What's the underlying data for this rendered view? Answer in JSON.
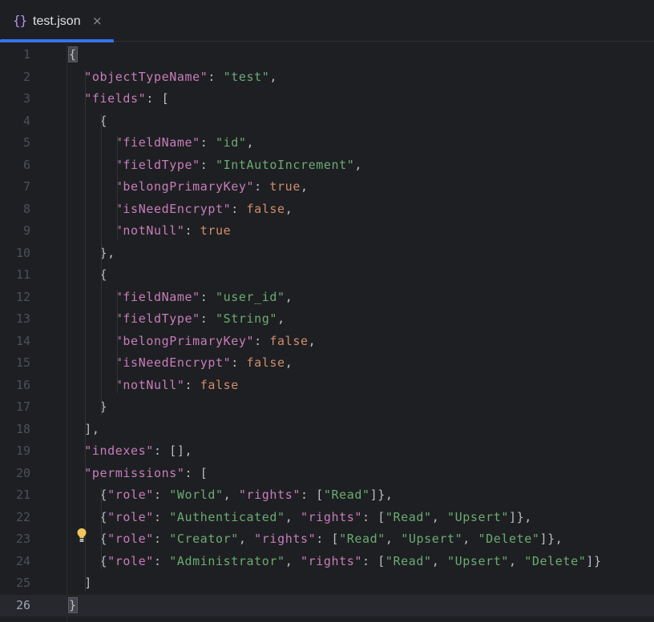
{
  "tab": {
    "icon": "{}",
    "label": "test.json",
    "close": "×"
  },
  "editor": {
    "current_line": 26,
    "lines": [
      {
        "n": "1",
        "tokens": [
          [
            "p",
            "{"
          ]
        ]
      },
      {
        "n": "2",
        "tokens": [
          [
            "p",
            "  "
          ],
          [
            "k",
            "\"objectTypeName\""
          ],
          [
            "p",
            ": "
          ],
          [
            "s",
            "\"test\""
          ],
          [
            "p",
            ","
          ]
        ]
      },
      {
        "n": "3",
        "tokens": [
          [
            "p",
            "  "
          ],
          [
            "k",
            "\"fields\""
          ],
          [
            "p",
            ": ["
          ]
        ]
      },
      {
        "n": "4",
        "tokens": [
          [
            "p",
            "    {"
          ]
        ]
      },
      {
        "n": "5",
        "tokens": [
          [
            "p",
            "      "
          ],
          [
            "k",
            "\"fieldName\""
          ],
          [
            "p",
            ": "
          ],
          [
            "s",
            "\"id\""
          ],
          [
            "p",
            ","
          ]
        ]
      },
      {
        "n": "6",
        "tokens": [
          [
            "p",
            "      "
          ],
          [
            "k",
            "\"fieldType\""
          ],
          [
            "p",
            ": "
          ],
          [
            "s",
            "\"IntAutoIncrement\""
          ],
          [
            "p",
            ","
          ]
        ]
      },
      {
        "n": "7",
        "tokens": [
          [
            "p",
            "      "
          ],
          [
            "k",
            "\"belongPrimaryKey\""
          ],
          [
            "p",
            ": "
          ],
          [
            "b",
            "true"
          ],
          [
            "p",
            ","
          ]
        ]
      },
      {
        "n": "8",
        "tokens": [
          [
            "p",
            "      "
          ],
          [
            "k",
            "\"isNeedEncrypt\""
          ],
          [
            "p",
            ": "
          ],
          [
            "b",
            "false"
          ],
          [
            "p",
            ","
          ]
        ]
      },
      {
        "n": "9",
        "tokens": [
          [
            "p",
            "      "
          ],
          [
            "k",
            "\"notNull\""
          ],
          [
            "p",
            ": "
          ],
          [
            "b",
            "true"
          ]
        ]
      },
      {
        "n": "10",
        "tokens": [
          [
            "p",
            "    },"
          ]
        ]
      },
      {
        "n": "11",
        "tokens": [
          [
            "p",
            "    {"
          ]
        ]
      },
      {
        "n": "12",
        "tokens": [
          [
            "p",
            "      "
          ],
          [
            "k",
            "\"fieldName\""
          ],
          [
            "p",
            ": "
          ],
          [
            "s",
            "\"user_id\""
          ],
          [
            "p",
            ","
          ]
        ]
      },
      {
        "n": "13",
        "tokens": [
          [
            "p",
            "      "
          ],
          [
            "k",
            "\"fieldType\""
          ],
          [
            "p",
            ": "
          ],
          [
            "s",
            "\"String\""
          ],
          [
            "p",
            ","
          ]
        ]
      },
      {
        "n": "14",
        "tokens": [
          [
            "p",
            "      "
          ],
          [
            "k",
            "\"belongPrimaryKey\""
          ],
          [
            "p",
            ": "
          ],
          [
            "b",
            "false"
          ],
          [
            "p",
            ","
          ]
        ]
      },
      {
        "n": "15",
        "tokens": [
          [
            "p",
            "      "
          ],
          [
            "k",
            "\"isNeedEncrypt\""
          ],
          [
            "p",
            ": "
          ],
          [
            "b",
            "false"
          ],
          [
            "p",
            ","
          ]
        ]
      },
      {
        "n": "16",
        "tokens": [
          [
            "p",
            "      "
          ],
          [
            "k",
            "\"notNull\""
          ],
          [
            "p",
            ": "
          ],
          [
            "b",
            "false"
          ]
        ]
      },
      {
        "n": "17",
        "tokens": [
          [
            "p",
            "    }"
          ]
        ]
      },
      {
        "n": "18",
        "tokens": [
          [
            "p",
            "  ],"
          ]
        ]
      },
      {
        "n": "19",
        "tokens": [
          [
            "p",
            "  "
          ],
          [
            "k",
            "\"indexes\""
          ],
          [
            "p",
            ": [],"
          ]
        ]
      },
      {
        "n": "20",
        "tokens": [
          [
            "p",
            "  "
          ],
          [
            "k",
            "\"permissions\""
          ],
          [
            "p",
            ": ["
          ]
        ]
      },
      {
        "n": "21",
        "tokens": [
          [
            "p",
            "    {"
          ],
          [
            "k",
            "\"role\""
          ],
          [
            "p",
            ": "
          ],
          [
            "s",
            "\"World\""
          ],
          [
            "p",
            ", "
          ],
          [
            "k",
            "\"rights\""
          ],
          [
            "p",
            ": ["
          ],
          [
            "s",
            "\"Read\""
          ],
          [
            "p",
            "]},"
          ]
        ]
      },
      {
        "n": "22",
        "tokens": [
          [
            "p",
            "    {"
          ],
          [
            "k",
            "\"role\""
          ],
          [
            "p",
            ": "
          ],
          [
            "s",
            "\"Authenticated\""
          ],
          [
            "p",
            ", "
          ],
          [
            "k",
            "\"rights\""
          ],
          [
            "p",
            ": ["
          ],
          [
            "s",
            "\"Read\""
          ],
          [
            "p",
            ", "
          ],
          [
            "s",
            "\"Upsert\""
          ],
          [
            "p",
            "]},"
          ]
        ]
      },
      {
        "n": "23",
        "tokens": [
          [
            "p",
            "    {"
          ],
          [
            "k",
            "\"role\""
          ],
          [
            "p",
            ": "
          ],
          [
            "s",
            "\"Creator\""
          ],
          [
            "p",
            ", "
          ],
          [
            "k",
            "\"rights\""
          ],
          [
            "p",
            ": ["
          ],
          [
            "s",
            "\"Read\""
          ],
          [
            "p",
            ", "
          ],
          [
            "s",
            "\"Upsert\""
          ],
          [
            "p",
            ", "
          ],
          [
            "s",
            "\"Delete\""
          ],
          [
            "p",
            "]},"
          ]
        ]
      },
      {
        "n": "24",
        "tokens": [
          [
            "p",
            "    {"
          ],
          [
            "k",
            "\"role\""
          ],
          [
            "p",
            ": "
          ],
          [
            "s",
            "\"Administrator\""
          ],
          [
            "p",
            ", "
          ],
          [
            "k",
            "\"rights\""
          ],
          [
            "p",
            ": ["
          ],
          [
            "s",
            "\"Read\""
          ],
          [
            "p",
            ", "
          ],
          [
            "s",
            "\"Upsert\""
          ],
          [
            "p",
            ", "
          ],
          [
            "s",
            "\"Delete\""
          ],
          [
            "p",
            "]}"
          ]
        ]
      },
      {
        "n": "25",
        "tokens": [
          [
            "p",
            "  ]"
          ]
        ]
      },
      {
        "n": "26",
        "tokens": [
          [
            "p",
            "}"
          ]
        ]
      }
    ]
  },
  "intention_icon": "lightbulb-icon",
  "colors": {
    "background": "#1e1f22",
    "key": "#c77dbb",
    "string": "#6aab73",
    "boolean": "#cf8e6d",
    "punctuation": "#bcbec4",
    "line_number": "#4b5059",
    "tab_accent": "#3574f0"
  }
}
